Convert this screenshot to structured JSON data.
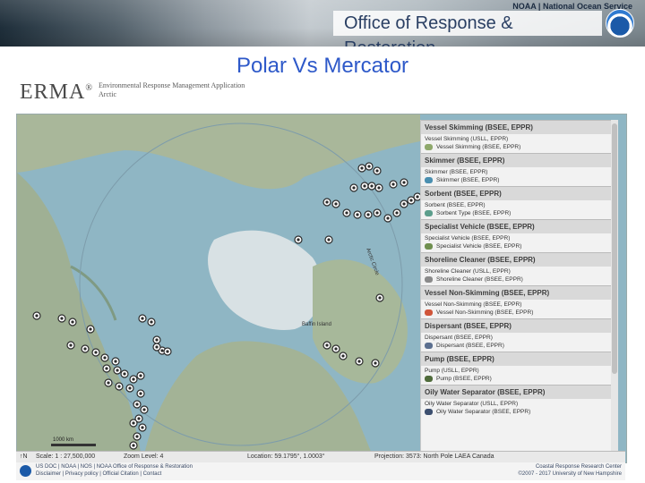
{
  "banner": {
    "agency_line": "NOAA | National Ocean Service",
    "office_title": "Office of Response & Restoration",
    "logo_text": "NOAA"
  },
  "slide": {
    "title": "Polar Vs Mercator"
  },
  "erma": {
    "logo": "ERMA",
    "reg": "®",
    "subtitle_line1": "Environmental Response Management Application",
    "subtitle_line2": "Arctic"
  },
  "map": {
    "scalebar_label": "1000 km",
    "places": [
      {
        "label": "Baffin Island"
      },
      {
        "label": "Arctic Circle"
      }
    ],
    "colors": {
      "ocean": "#8fb6c4",
      "land": "#a9b79a",
      "land_dark": "#7f9a83",
      "ice": "#d8e1e4"
    }
  },
  "legend": {
    "sections": [
      {
        "header": "Vessel Skimming (BSEE, EPPR)",
        "sub": "Vessel Skimming (USLL, EPPR)",
        "item": "Vessel Skimming (BSEE, EPPR)",
        "color": "#8ea86b"
      },
      {
        "header": "Skimmer (BSEE, EPPR)",
        "sub": "Skimmer (BSEE, EPPR)",
        "item": "Skimmer (BSEE, EPPR)",
        "color": "#4a8fb0"
      },
      {
        "header": "Sorbent (BSEE, EPPR)",
        "sub": "Sorbent (BSEE, EPPR)",
        "item": "Sorbent Type (BSEE, EPPR)",
        "color": "#5c9e8c"
      },
      {
        "header": "Specialist Vehicle (BSEE, EPPR)",
        "sub": "Specialist Vehicle (BSEE, EPPR)",
        "item": "Specialist Vehicle (BSEE, EPPR)",
        "color": "#6f8f4f"
      },
      {
        "header": "Shoreline Cleaner (BSEE, EPPR)",
        "sub": "Shoreline Cleaner (USLL, EPPR)",
        "item": "Shoreline Cleaner (BSEE, EPPR)",
        "color": "#8a8a8a"
      },
      {
        "header": "Vessel Non-Skimming (BSEE, EPPR)",
        "sub": "Vessel Non-Skimming (BSEE, EPPR)",
        "item": "Vessel Non-Skimming (BSEE, EPPR)",
        "color": "#d0553a"
      },
      {
        "header": "Dispersant (BSEE, EPPR)",
        "sub": "Dispersant (BSEE, EPPR)",
        "item": "Dispersant (BSEE, EPPR)",
        "color": "#5b6f8f"
      },
      {
        "header": "Pump (BSEE, EPPR)",
        "sub": "Pump (USLL, EPPR)",
        "item": "Pump (BSEE, EPPR)",
        "color": "#4f6b3a"
      },
      {
        "header": "Oily Water Separator (BSEE, EPPR)",
        "sub": "Oily Water Separator (USLL, EPPR)",
        "item": "Oily Water Separator (BSEE, EPPR)",
        "color": "#3c4f6f"
      }
    ]
  },
  "status": {
    "scale_label": "Scale: 1 : 27,500,000",
    "zoom_label": "Zoom Level: 4",
    "location_label": "Location: 59.1795°, 1.0003°",
    "projection_label": "Projection: 3573: North Pole LAEA Canada"
  },
  "footer": {
    "left_line1": "US DOC | NOAA | NOS | NOAA Office of Response & Restoration",
    "left_line2": "Disclaimer | Privacy policy | Official Citation | Contact",
    "right_line1": "Coastal Response Research Center",
    "right_line2": "©2007 - 2017 University of New Hampshire"
  }
}
